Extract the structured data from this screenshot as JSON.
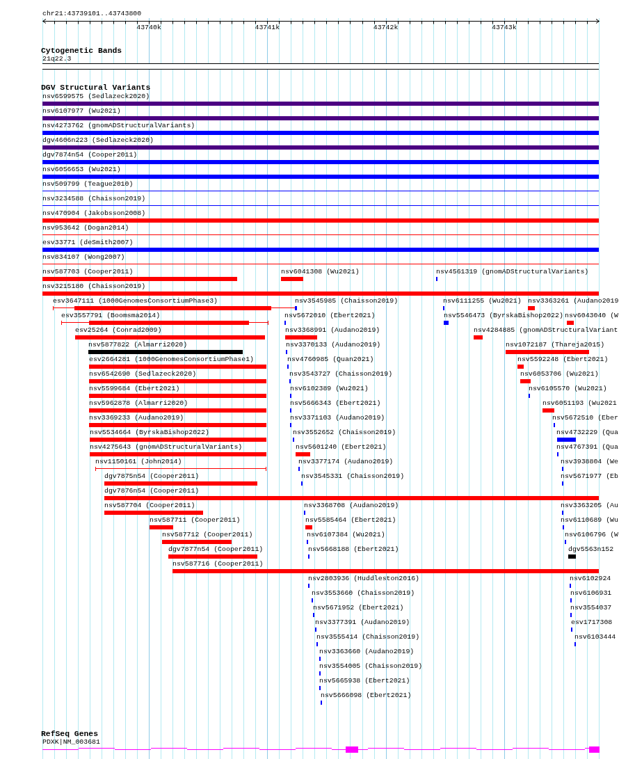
{
  "ruler": {
    "region": "chr21:43739101..43743800",
    "tick_labels": [
      "43740k",
      "43741k",
      "43742k",
      "43743k"
    ]
  },
  "tracks": [
    {
      "title": "Cytogenetic Bands",
      "kind": "cytoband",
      "features": [
        {
          "label": "21q22.3"
        }
      ]
    },
    {
      "title": "DGV Structural Variants",
      "kind": "variants",
      "rows": [
        [
          {
            "label": "nsv6599575 (Sedlazeck2020)",
            "color": "#4b0082",
            "kind": "bar"
          }
        ],
        [
          {
            "label": "nsv6107977 (Wu2021)",
            "color": "#4b0082",
            "kind": "bar"
          }
        ],
        [
          {
            "label": "nsv4273762 (gnomADStructuralVariants)",
            "color": "#0000ff",
            "kind": "bar"
          }
        ],
        [
          {
            "label": "dgv4606n223 (Sedlazeck2020)",
            "color": "#4b0082",
            "kind": "bar"
          }
        ],
        [
          {
            "label": "dgv7874n54 (Cooper2011)",
            "color": "#0000ff",
            "kind": "bar"
          }
        ],
        [
          {
            "label": "nsv6056653 (Wu2021)",
            "color": "#0000ff",
            "kind": "bar"
          }
        ],
        [
          {
            "label": "nsv509799 (Teague2010)",
            "color": "#0000ff",
            "kind": "line"
          }
        ],
        [
          {
            "label": "nsv3234588 (Chaisson2019)",
            "color": "#0000ff",
            "kind": "line"
          }
        ],
        [
          {
            "label": "nsv470904 (Jakobsson2008)",
            "color": "#ff0000",
            "kind": "bar"
          }
        ],
        [
          {
            "label": "nsv953642 (Dogan2014)",
            "color": "#ff0000",
            "kind": "line"
          }
        ],
        [
          {
            "label": "esv33771 (deSmith2007)",
            "color": "#0000ff",
            "kind": "bar"
          }
        ],
        [
          {
            "label": "nsv834107 (Wong2007)",
            "color": "#ff0000",
            "kind": "line"
          }
        ],
        [
          {
            "label": "nsv587703 (Cooper2011)",
            "color": "#ff0000",
            "kind": "bar"
          },
          {
            "label": "nsv6041308 (Wu2021)",
            "color": "#ff0000",
            "kind": "bar"
          },
          {
            "label": "nsv4561319 (gnomADStructuralVariants)",
            "color": "#0000ff",
            "kind": "bar"
          }
        ],
        [
          {
            "label": "nsv3215180 (Chaisson2019)",
            "color": "#ff0000",
            "kind": "bar"
          }
        ],
        [
          {
            "label": "esv3647111 (1000GenomesConsortiumPhase3)",
            "color": "#ff0000",
            "kind": "whisker"
          },
          {
            "label": "nsv3545985 (Chaisson2019)",
            "color": "#0000ff",
            "kind": "bar"
          },
          {
            "label": "nsv6111255 (Wu2021)",
            "color": "#0000ff",
            "kind": "bar"
          },
          {
            "label": "nsv3363261 (Audano2019",
            "color": "#ff0000",
            "kind": "bar"
          }
        ],
        [
          {
            "label": "esv3557791 (Boomsma2014)",
            "color": "#ff0000",
            "kind": "whisker"
          },
          {
            "label": "nsv5672010 (Ebert2021)",
            "color": "#0000ff",
            "kind": "bar"
          },
          {
            "label": "nsv5546473 (ByrskaBishop2022)",
            "color": "#0000ff",
            "kind": "bar"
          },
          {
            "label": "nsv6043040 (W",
            "color": "#ff0000",
            "kind": "bar"
          }
        ],
        [
          {
            "label": "esv25264 (Conrad2009)",
            "color": "#ff0000",
            "kind": "bar"
          },
          {
            "label": "nsv3368991 (Audano2019)",
            "color": "#ff0000",
            "kind": "bar"
          },
          {
            "label": "nsv4284885 (gnomADStructuralVariant",
            "color": "#ff0000",
            "kind": "bar"
          }
        ],
        [
          {
            "label": "nsv5877822 (Almarri2020)",
            "color": "#000000",
            "kind": "bar"
          },
          {
            "label": "nsv3370133 (Audano2019)",
            "color": "#0000ff",
            "kind": "bar"
          },
          {
            "label": "nsv1072187 (Thareja2015)",
            "color": "#ff0000",
            "kind": "bar"
          }
        ],
        [
          {
            "label": "esv2664281 (1000GenomesConsortiumPhase1)",
            "color": "#ff0000",
            "kind": "bar"
          },
          {
            "label": "nsv4760985 (Quan2021)",
            "color": "#0000ff",
            "kind": "bar"
          },
          {
            "label": "nsv5592248 (Ebert2021)",
            "color": "#ff0000",
            "kind": "bar"
          }
        ],
        [
          {
            "label": "nsv6542690 (Sedlazeck2020)",
            "color": "#ff0000",
            "kind": "bar"
          },
          {
            "label": "nsv3543727 (Chaisson2019)",
            "color": "#0000ff",
            "kind": "bar"
          },
          {
            "label": "nsv6053706 (Wu2021)",
            "color": "#ff0000",
            "kind": "bar"
          }
        ],
        [
          {
            "label": "nsv5599684 (Ebert2021)",
            "color": "#ff0000",
            "kind": "bar"
          },
          {
            "label": "nsv6102389 (Wu2021)",
            "color": "#0000ff",
            "kind": "bar"
          },
          {
            "label": "nsv6105570 (Wu2021)",
            "color": "#0000ff",
            "kind": "bar"
          }
        ],
        [
          {
            "label": "nsv5962878 (Almarri2020)",
            "color": "#ff0000",
            "kind": "bar"
          },
          {
            "label": "nsv5666343 (Ebert2021)",
            "color": "#0000ff",
            "kind": "bar"
          },
          {
            "label": "nsv6051193 (Wu2021",
            "color": "#ff0000",
            "kind": "bar"
          }
        ],
        [
          {
            "label": "nsv3369233 (Audano2019)",
            "color": "#ff0000",
            "kind": "bar"
          },
          {
            "label": "nsv3371103 (Audano2019)",
            "color": "#0000ff",
            "kind": "bar"
          },
          {
            "label": "nsv5672510 (Eber",
            "color": "#0000ff",
            "kind": "bar"
          }
        ],
        [
          {
            "label": "nsv5534664 (ByrskaBishop2022)",
            "color": "#ff0000",
            "kind": "bar"
          },
          {
            "label": "nsv3552652 (Chaisson2019)",
            "color": "#0000ff",
            "kind": "bar"
          },
          {
            "label": "nsv4732229 (Qua",
            "color": "#0000ff",
            "kind": "bar"
          }
        ],
        [
          {
            "label": "nsv4275643 (gnomADStructuralVariants)",
            "color": "#ff0000",
            "kind": "bar"
          },
          {
            "label": "nsv5601240 (Ebert2021)",
            "color": "#ff0000",
            "kind": "bar"
          },
          {
            "label": "nsv4767391 (Qua",
            "color": "#0000ff",
            "kind": "bar"
          }
        ],
        [
          {
            "label": "nsv1150161 (John2014)",
            "color": "#ff0000",
            "kind": "whisker"
          },
          {
            "label": "nsv3377174 (Audano2019)",
            "color": "#0000ff",
            "kind": "bar"
          },
          {
            "label": "nsv3938804 (We",
            "color": "#0000ff",
            "kind": "bar"
          }
        ],
        [
          {
            "label": "dgv7875n54 (Cooper2011)",
            "color": "#ff0000",
            "kind": "bar"
          },
          {
            "label": "nsv3545331 (Chaisson2019)",
            "color": "#0000ff",
            "kind": "bar"
          },
          {
            "label": "nsv5671977 (Eb",
            "color": "#0000ff",
            "kind": "bar"
          }
        ],
        [
          {
            "label": "dgv7876n54 (Cooper2011)",
            "color": "#ff0000",
            "kind": "bar"
          }
        ],
        [
          {
            "label": "nsv587704 (Cooper2011)",
            "color": "#ff0000",
            "kind": "bar"
          },
          {
            "label": "nsv3368708 (Audano2019)",
            "color": "#0000ff",
            "kind": "bar"
          },
          {
            "label": "nsv3363205 (Au",
            "color": "#0000ff",
            "kind": "bar"
          }
        ],
        [
          {
            "label": "nsv587711 (Cooper2011)",
            "color": "#ff0000",
            "kind": "bar"
          },
          {
            "label": "nsv5585464 (Ebert2021)",
            "color": "#ff0000",
            "kind": "bar"
          },
          {
            "label": "nsv6110689 (Wu",
            "color": "#0000ff",
            "kind": "bar"
          }
        ],
        [
          {
            "label": "nsv587712 (Cooper2011)",
            "color": "#ff0000",
            "kind": "bar"
          },
          {
            "label": "nsv6107384 (Wu2021)",
            "color": "#0000ff",
            "kind": "bar"
          },
          {
            "label": "nsv6106796 (W",
            "color": "#0000ff",
            "kind": "bar"
          }
        ],
        [
          {
            "label": "dgv7877n54 (Cooper2011)",
            "color": "#ff0000",
            "kind": "bar"
          },
          {
            "label": "nsv5668188 (Ebert2021)",
            "color": "#0000ff",
            "kind": "bar"
          },
          {
            "label": "dgv5563n152",
            "color": "#000000",
            "kind": "bar"
          }
        ],
        [
          {
            "label": "nsv587716 (Cooper2011)",
            "color": "#ff0000",
            "kind": "bar"
          }
        ],
        [
          {
            "label": "nsv2803936 (Huddleston2016)",
            "color": "#0000ff",
            "kind": "bar"
          },
          {
            "label": "nsv6102924",
            "color": "#0000ff",
            "kind": "bar"
          }
        ],
        [
          {
            "label": "nsv3553660 (Chaisson2019)",
            "color": "#0000ff",
            "kind": "bar"
          },
          {
            "label": "nsv6106931",
            "color": "#0000ff",
            "kind": "bar"
          }
        ],
        [
          {
            "label": "nsv5671952 (Ebert2021)",
            "color": "#0000ff",
            "kind": "bar"
          },
          {
            "label": "nsv3554037",
            "color": "#0000ff",
            "kind": "bar"
          }
        ],
        [
          {
            "label": "nsv3377391 (Audano2019)",
            "color": "#0000ff",
            "kind": "bar"
          },
          {
            "label": "esv1717308",
            "color": "#0000ff",
            "kind": "bar"
          }
        ],
        [
          {
            "label": "nsv3555414 (Chaisson2019)",
            "color": "#0000ff",
            "kind": "bar"
          },
          {
            "label": "nsv6103444",
            "color": "#0000ff",
            "kind": "bar"
          }
        ],
        [
          {
            "label": "nsv3363660 (Audano2019)",
            "color": "#0000ff",
            "kind": "bar"
          }
        ],
        [
          {
            "label": "nsv3554005 (Chaisson2019)",
            "color": "#0000ff",
            "kind": "bar"
          }
        ],
        [
          {
            "label": "nsv5665938 (Ebert2021)",
            "color": "#0000ff",
            "kind": "bar"
          }
        ],
        [
          {
            "label": "nsv5666098 (Ebert2021)",
            "color": "#0000ff",
            "kind": "bar"
          }
        ]
      ]
    },
    {
      "title": "RefSeq Genes",
      "kind": "genes",
      "features": [
        {
          "label": "PDXK|NM_003681"
        }
      ]
    }
  ]
}
